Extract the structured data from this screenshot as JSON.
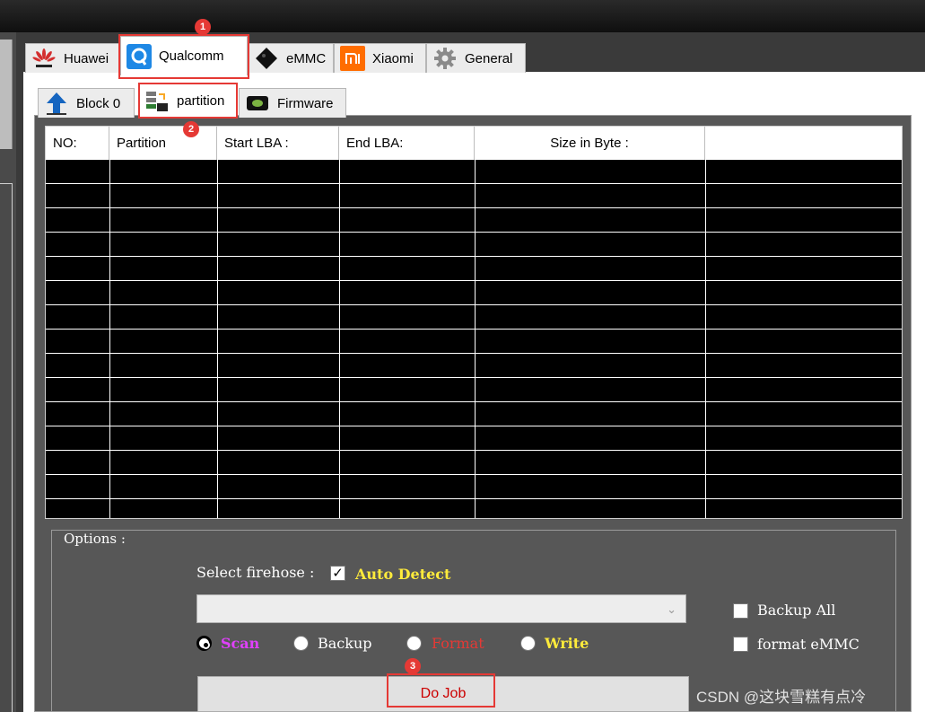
{
  "main_tabs": [
    {
      "label": "Huawei",
      "icon": "huawei-logo-icon"
    },
    {
      "label": "Qualcomm",
      "icon": "qualcomm-logo-icon"
    },
    {
      "label": "eMMC",
      "icon": "emmc-chip-icon"
    },
    {
      "label": "Xiaomi",
      "icon": "xiaomi-logo-icon"
    },
    {
      "label": "General",
      "icon": "gear-icon"
    }
  ],
  "sub_tabs": [
    {
      "label": "Block 0",
      "icon": "upload-arrow-icon"
    },
    {
      "label": "partition",
      "icon": "partition-icon"
    },
    {
      "label": "Firmware",
      "icon": "firmware-chip-icon"
    }
  ],
  "table": {
    "columns": [
      "NO:",
      "Partition",
      "Start LBA :",
      "End LBA:",
      "Size in Byte :",
      ""
    ]
  },
  "options": {
    "legend": "Options :",
    "select_firehose_label": "Select firehose :",
    "auto_detect_label": "Auto Detect",
    "auto_detect_checked": true,
    "firehose_value": "",
    "radios": [
      {
        "label": "Scan",
        "color": "#e040fb",
        "selected": true
      },
      {
        "label": "Backup",
        "color": "#ffffff",
        "selected": false
      },
      {
        "label": "Format",
        "color": "#e53935",
        "selected": false
      },
      {
        "label": "Write",
        "color": "#ffeb3b",
        "selected": false
      }
    ],
    "backup_all_label": "Backup All",
    "format_emmc_label": "format eMMC",
    "do_job_label": "Do Job"
  },
  "annotations": [
    "1",
    "2",
    "3"
  ],
  "watermark": "CSDN @这块雪糕有点冷",
  "colors": {
    "highlight": "#e53935",
    "auto_detect": "#ffeb3b"
  }
}
